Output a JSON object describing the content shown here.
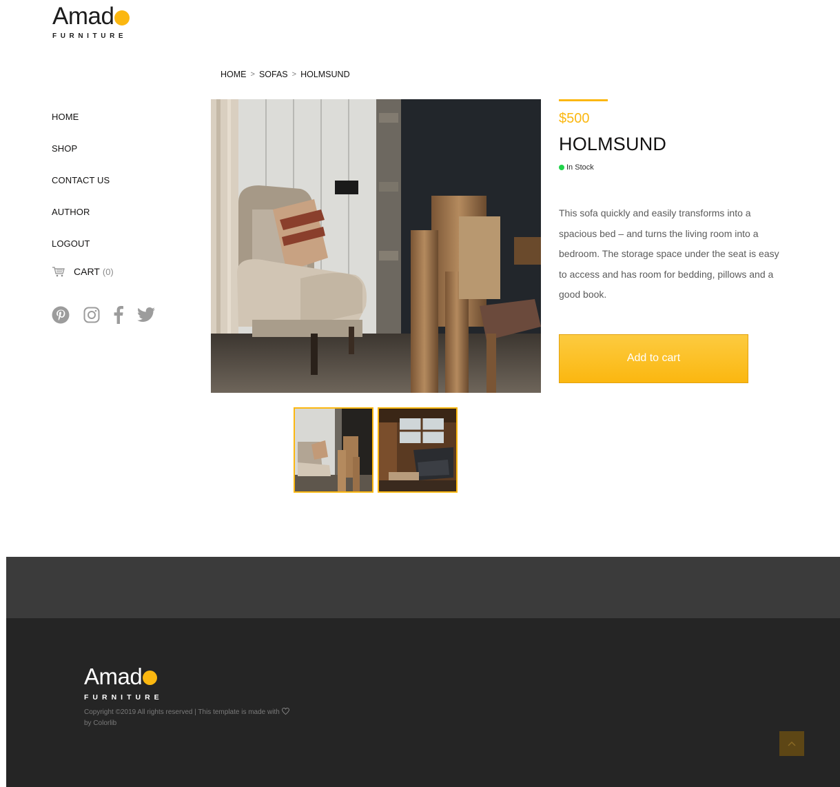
{
  "brand": {
    "name": "Amad",
    "tagline": "FURNITURE",
    "accent_color": "#fbb710"
  },
  "nav": {
    "items": [
      {
        "label": "HOME"
      },
      {
        "label": "SHOP"
      },
      {
        "label": "CONTACT US"
      },
      {
        "label": "AUTHOR"
      },
      {
        "label": "LOGOUT"
      }
    ],
    "cart": {
      "label": "CART",
      "count": "(0)",
      "icon": "cart-icon"
    },
    "social": [
      "pinterest-icon",
      "instagram-icon",
      "facebook-icon",
      "twitter-icon"
    ]
  },
  "breadcrumb": {
    "items": [
      "HOME",
      "SOFAS",
      "HOLMSUND"
    ],
    "separator": ">"
  },
  "product": {
    "price": "$500",
    "name": "HOLMSUND",
    "stock": "In Stock",
    "stock_color": "#20d34a",
    "description": "This sofa quickly and easily transforms into a spacious bed – and turns the living room into a bedroom. The storage space under the seat is easy to access and has room for bedding, pillows and a good book.",
    "add_to_cart": "Add to cart",
    "thumbnails": 2
  },
  "footer": {
    "brand": "Amad",
    "tagline": "FURNITURE",
    "copyright_pre": "Copyright ©2019 All rights reserved | This template is made with",
    "copyright_post": "by Colorlib",
    "back_to_top_icon": "chevron-up-icon"
  }
}
